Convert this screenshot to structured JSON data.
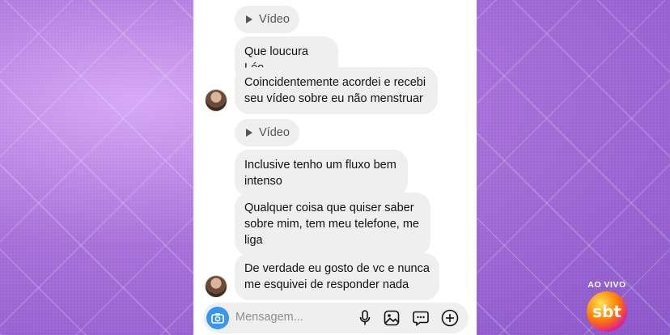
{
  "chat": {
    "video_label_1": "Vídeo",
    "message_1": "Que loucura Léo",
    "message_2": "Coincidentemente acordei e recebi seu vídeo sobre eu não menstruar",
    "video_label_2": "Vídeo",
    "message_3": "Inclusive tenho um fluxo bem intenso",
    "message_4": "Qualquer coisa que quiser saber sobre mim, tem meu telefone, me liga",
    "message_5": "De verdade eu gosto de vc e nunca me esquivei de responder nada"
  },
  "composer": {
    "placeholder": "Mensagem...",
    "icons": [
      "camera-icon",
      "microphone-icon",
      "gallery-icon",
      "sticker-icon",
      "add-icon"
    ]
  },
  "broadcast": {
    "live_label": "AO VIVO",
    "logo_text": "sbt"
  },
  "colors": {
    "background": "#b77fe0",
    "bubble": "#efefef",
    "accent": "#3797f0"
  }
}
